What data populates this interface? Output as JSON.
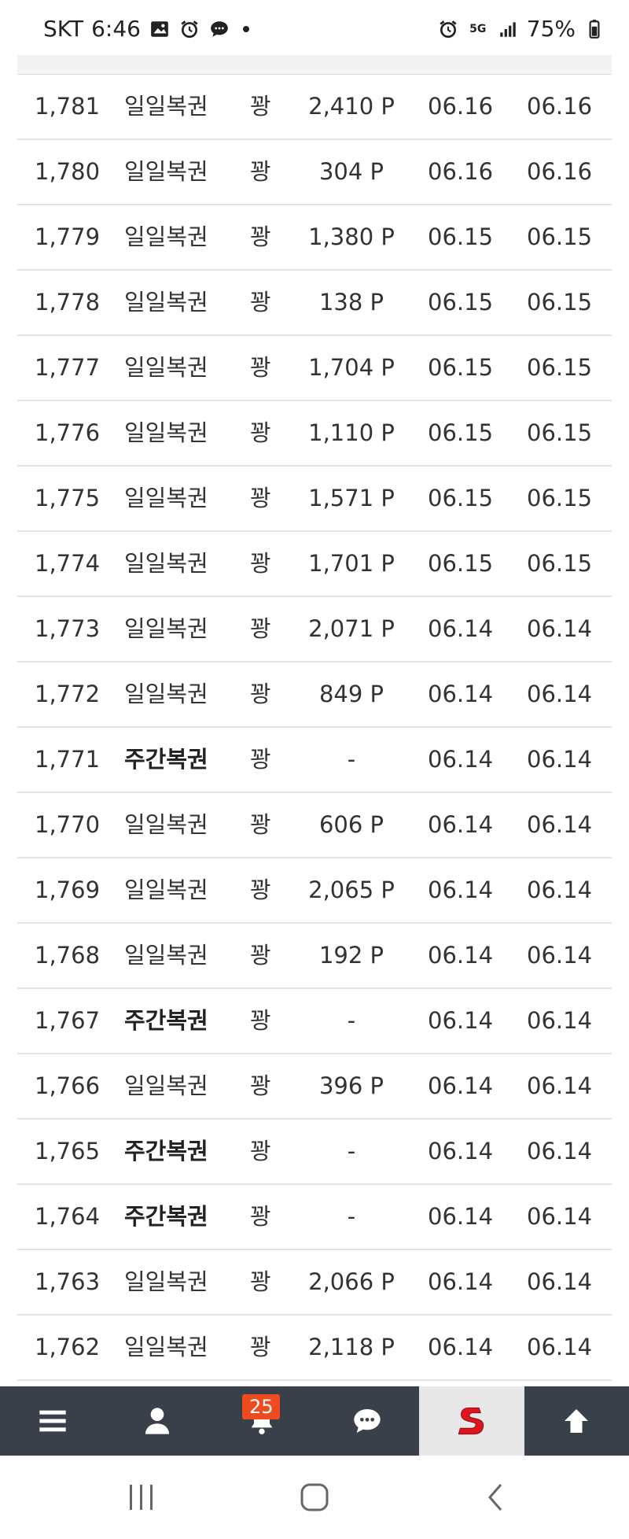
{
  "status_bar": {
    "carrier": "SKT",
    "time": "6:46",
    "network": "5G",
    "battery": "75%"
  },
  "table": {
    "rows": [
      {
        "num": "1,781",
        "type": "일일복권",
        "bold": false,
        "result": "꽝",
        "points": "2,410 P",
        "date1": "06.16",
        "date2": "06.16"
      },
      {
        "num": "1,780",
        "type": "일일복권",
        "bold": false,
        "result": "꽝",
        "points": "304 P",
        "date1": "06.16",
        "date2": "06.16"
      },
      {
        "num": "1,779",
        "type": "일일복권",
        "bold": false,
        "result": "꽝",
        "points": "1,380 P",
        "date1": "06.15",
        "date2": "06.15"
      },
      {
        "num": "1,778",
        "type": "일일복권",
        "bold": false,
        "result": "꽝",
        "points": "138 P",
        "date1": "06.15",
        "date2": "06.15"
      },
      {
        "num": "1,777",
        "type": "일일복권",
        "bold": false,
        "result": "꽝",
        "points": "1,704 P",
        "date1": "06.15",
        "date2": "06.15"
      },
      {
        "num": "1,776",
        "type": "일일복권",
        "bold": false,
        "result": "꽝",
        "points": "1,110 P",
        "date1": "06.15",
        "date2": "06.15"
      },
      {
        "num": "1,775",
        "type": "일일복권",
        "bold": false,
        "result": "꽝",
        "points": "1,571 P",
        "date1": "06.15",
        "date2": "06.15"
      },
      {
        "num": "1,774",
        "type": "일일복권",
        "bold": false,
        "result": "꽝",
        "points": "1,701 P",
        "date1": "06.15",
        "date2": "06.15"
      },
      {
        "num": "1,773",
        "type": "일일복권",
        "bold": false,
        "result": "꽝",
        "points": "2,071 P",
        "date1": "06.14",
        "date2": "06.14"
      },
      {
        "num": "1,772",
        "type": "일일복권",
        "bold": false,
        "result": "꽝",
        "points": "849 P",
        "date1": "06.14",
        "date2": "06.14"
      },
      {
        "num": "1,771",
        "type": "주간복권",
        "bold": true,
        "result": "꽝",
        "points": "-",
        "date1": "06.14",
        "date2": "06.14"
      },
      {
        "num": "1,770",
        "type": "일일복권",
        "bold": false,
        "result": "꽝",
        "points": "606 P",
        "date1": "06.14",
        "date2": "06.14"
      },
      {
        "num": "1,769",
        "type": "일일복권",
        "bold": false,
        "result": "꽝",
        "points": "2,065 P",
        "date1": "06.14",
        "date2": "06.14"
      },
      {
        "num": "1,768",
        "type": "일일복권",
        "bold": false,
        "result": "꽝",
        "points": "192 P",
        "date1": "06.14",
        "date2": "06.14"
      },
      {
        "num": "1,767",
        "type": "주간복권",
        "bold": true,
        "result": "꽝",
        "points": "-",
        "date1": "06.14",
        "date2": "06.14"
      },
      {
        "num": "1,766",
        "type": "일일복권",
        "bold": false,
        "result": "꽝",
        "points": "396 P",
        "date1": "06.14",
        "date2": "06.14"
      },
      {
        "num": "1,765",
        "type": "주간복권",
        "bold": true,
        "result": "꽝",
        "points": "-",
        "date1": "06.14",
        "date2": "06.14"
      },
      {
        "num": "1,764",
        "type": "주간복권",
        "bold": true,
        "result": "꽝",
        "points": "-",
        "date1": "06.14",
        "date2": "06.14"
      },
      {
        "num": "1,763",
        "type": "일일복권",
        "bold": false,
        "result": "꽝",
        "points": "2,066 P",
        "date1": "06.14",
        "date2": "06.14"
      },
      {
        "num": "1,762",
        "type": "일일복권",
        "bold": false,
        "result": "꽝",
        "points": "2,118 P",
        "date1": "06.14",
        "date2": "06.14"
      }
    ]
  },
  "bottom_nav": {
    "items": [
      {
        "icon": "menu-icon"
      },
      {
        "icon": "user-icon"
      },
      {
        "icon": "bell-icon"
      },
      {
        "icon": "chat-icon"
      },
      {
        "icon": "site-logo"
      },
      {
        "icon": "arrow-up-icon"
      }
    ],
    "notification_count": "25",
    "background": "#3a4049",
    "badge_color": "#f04a1f",
    "logo_color": "#e0141e"
  },
  "system_nav": {
    "items": [
      "recent-apps-icon",
      "home-icon",
      "back-icon"
    ]
  }
}
